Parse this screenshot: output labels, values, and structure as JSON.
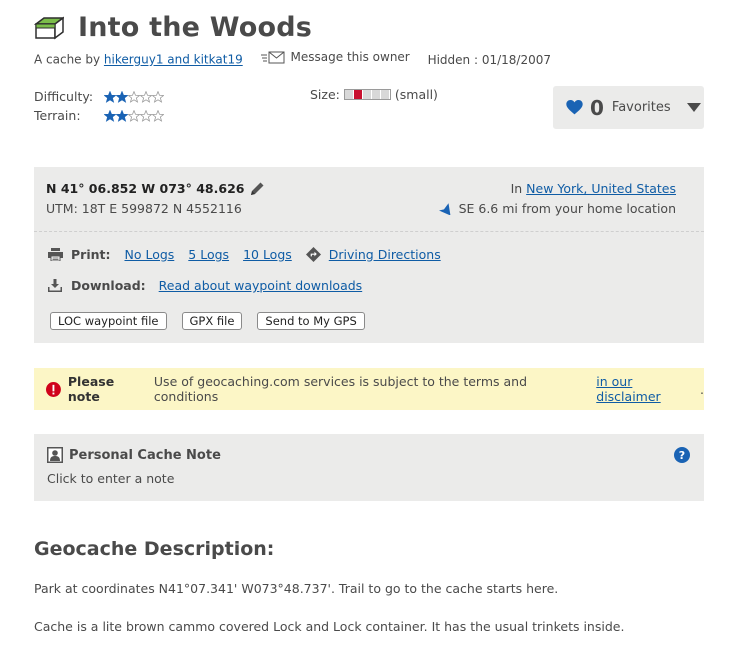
{
  "header": {
    "title": "Into the Woods",
    "cache_icon": "traditional-cache-icon",
    "byline_prefix": "A cache by",
    "owner": "hikerguy1 and kitkat19",
    "message_owner": "Message this owner",
    "hidden": "Hidden : 01/18/2007"
  },
  "ratings": {
    "difficulty_label": "Difficulty:",
    "difficulty_value": 2.0,
    "terrain_label": "Terrain:",
    "terrain_value": 2.0,
    "max": 5,
    "star_color": "#1a63b4",
    "size_label": "Size:",
    "size_value": "(small)"
  },
  "favorites": {
    "count": "0",
    "label": "Favorites",
    "heart_color": "#1a63b4"
  },
  "location": {
    "coords": "N 41° 06.852 W 073° 48.626",
    "utm": "UTM: 18T E 599872 N 4552116",
    "in_prefix": "In",
    "place": "New York, United States",
    "distance": "SE 6.6 mi from your home location"
  },
  "print": {
    "label": "Print:",
    "no_logs": "No Logs",
    "five_logs": "5 Logs",
    "ten_logs": "10 Logs",
    "driving_directions": "Driving Directions"
  },
  "download": {
    "label": "Download:",
    "read_about": "Read about waypoint downloads",
    "buttons": [
      "LOC waypoint file",
      "GPX file",
      "Send to My GPS"
    ]
  },
  "notice": {
    "bold": "Please note",
    "text": "Use of geocaching.com services is subject to the terms and conditions",
    "link": "in our disclaimer",
    "end": ".",
    "icon_color": "#d0021b"
  },
  "personal_note": {
    "title": "Personal Cache Note",
    "placeholder": "Click to enter a note"
  },
  "description": {
    "heading": "Geocache Description:",
    "paragraphs": [
      "Park at coordinates N41°07.341' W073°48.737'. Trail to go to the cache starts here.",
      "Cache is a lite brown cammo covered Lock and Lock container. It has the usual trinkets inside."
    ]
  }
}
